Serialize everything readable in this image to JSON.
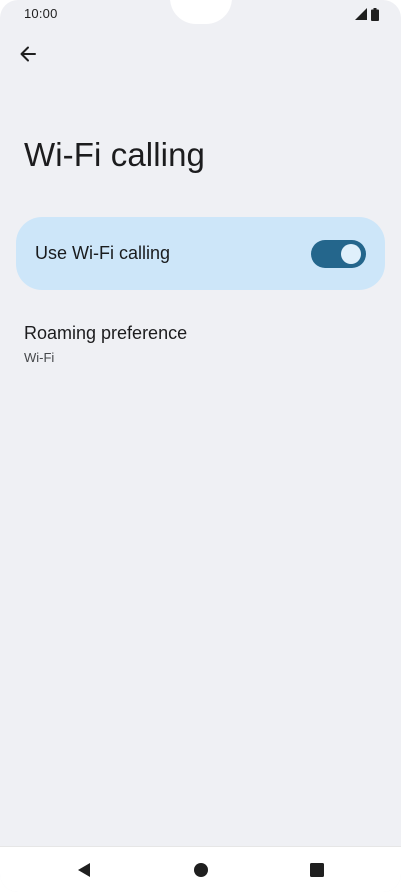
{
  "status_bar": {
    "time": "10:00",
    "icons": [
      "signal-icon",
      "battery-icon"
    ]
  },
  "header": {
    "back_icon": "arrow-left-icon",
    "title": "Wi-Fi calling"
  },
  "wifi_calling_toggle": {
    "label": "Use Wi-Fi calling",
    "state": "on",
    "accent_color": "#24668c",
    "card_color": "#cde6f9"
  },
  "roaming_preference": {
    "title": "Roaming preference",
    "summary": "Wi-Fi"
  },
  "nav_bar": {
    "buttons": [
      "back-triangle-icon",
      "home-circle-icon",
      "recents-square-icon"
    ]
  }
}
